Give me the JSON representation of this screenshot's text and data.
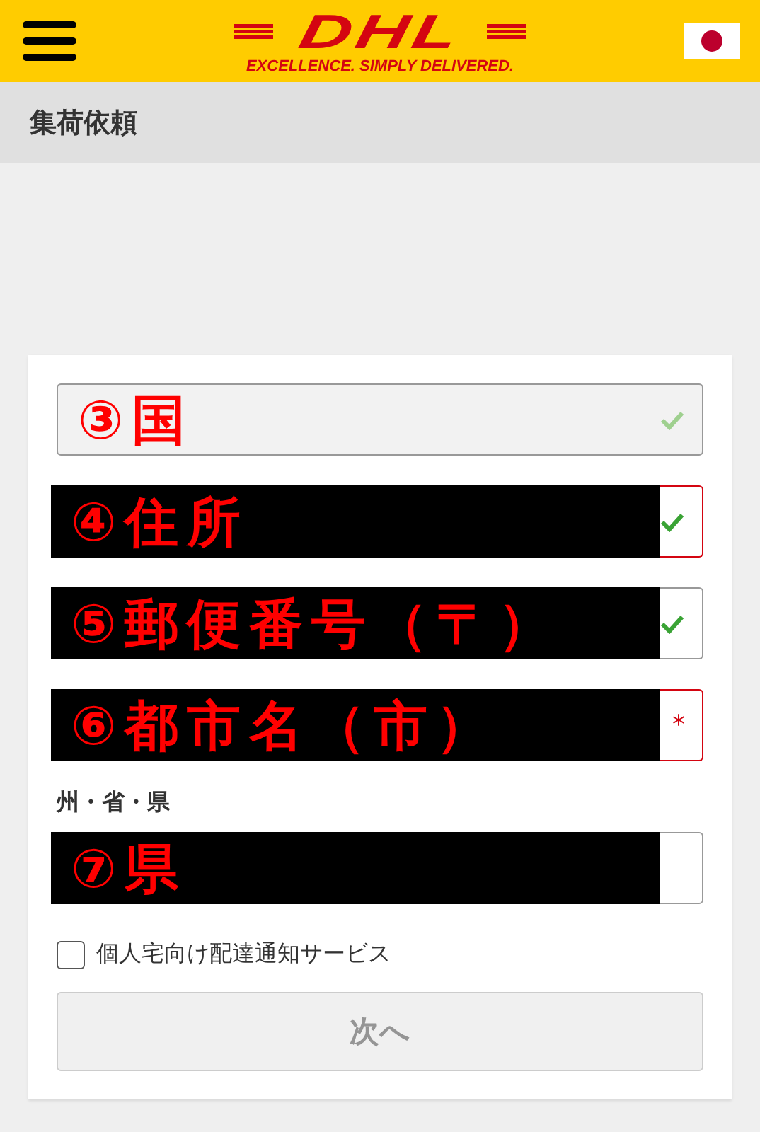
{
  "header": {
    "logo": {
      "wordmark": "DHL",
      "tagline": "EXCELLENCE. SIMPLY DELIVERED."
    }
  },
  "page_title": "集荷依頼",
  "form": {
    "fields": [
      {
        "annotation": "③国",
        "redacted": false,
        "disabled": true,
        "error": false,
        "valid": true
      },
      {
        "annotation": "④住所",
        "redacted": true,
        "disabled": false,
        "error": true,
        "valid": true
      },
      {
        "annotation": "⑤郵便番号（〒）",
        "redacted": true,
        "disabled": false,
        "error": false,
        "valid": true
      },
      {
        "annotation": "⑥都市名（市）",
        "redacted": true,
        "disabled": false,
        "error": true,
        "valid": false,
        "required_mark": "*"
      },
      {
        "label": "州・省・県",
        "annotation": "⑦県",
        "redacted": true,
        "disabled": false,
        "error": false,
        "valid": false
      }
    ],
    "checkbox": {
      "label": "個人宅向け配達通知サービス",
      "checked": false
    },
    "button": {
      "label": "次へ",
      "disabled": true
    }
  }
}
